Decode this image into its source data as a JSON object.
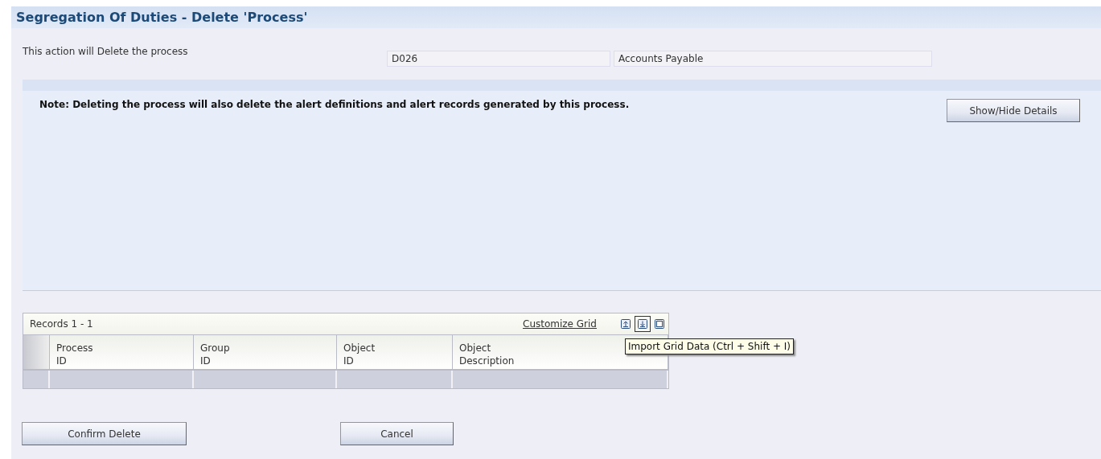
{
  "title": "Segregation Of Duties - Delete 'Process'",
  "action": {
    "label": "This action will Delete the process",
    "process_id": "D026",
    "process_name": "Accounts Payable"
  },
  "note": {
    "text": "Note: Deleting the process will also delete the alert definitions and alert records generated by this process.",
    "button": "Show/Hide Details"
  },
  "grid": {
    "records": "Records 1 - 1",
    "customize": "Customize Grid",
    "tools": [
      {
        "kind": "export",
        "hovered": false
      },
      {
        "kind": "import",
        "hovered": true
      },
      {
        "kind": "maximize",
        "hovered": false
      }
    ],
    "tooltip": "Import Grid Data (Ctrl + Shift + I)",
    "columns": [
      [
        "Process",
        "ID"
      ],
      [
        "Group",
        "ID"
      ],
      [
        "Object",
        "ID"
      ],
      [
        "Object",
        "Description"
      ]
    ]
  },
  "buttons": [
    "Confirm Delete",
    "Cancel"
  ]
}
